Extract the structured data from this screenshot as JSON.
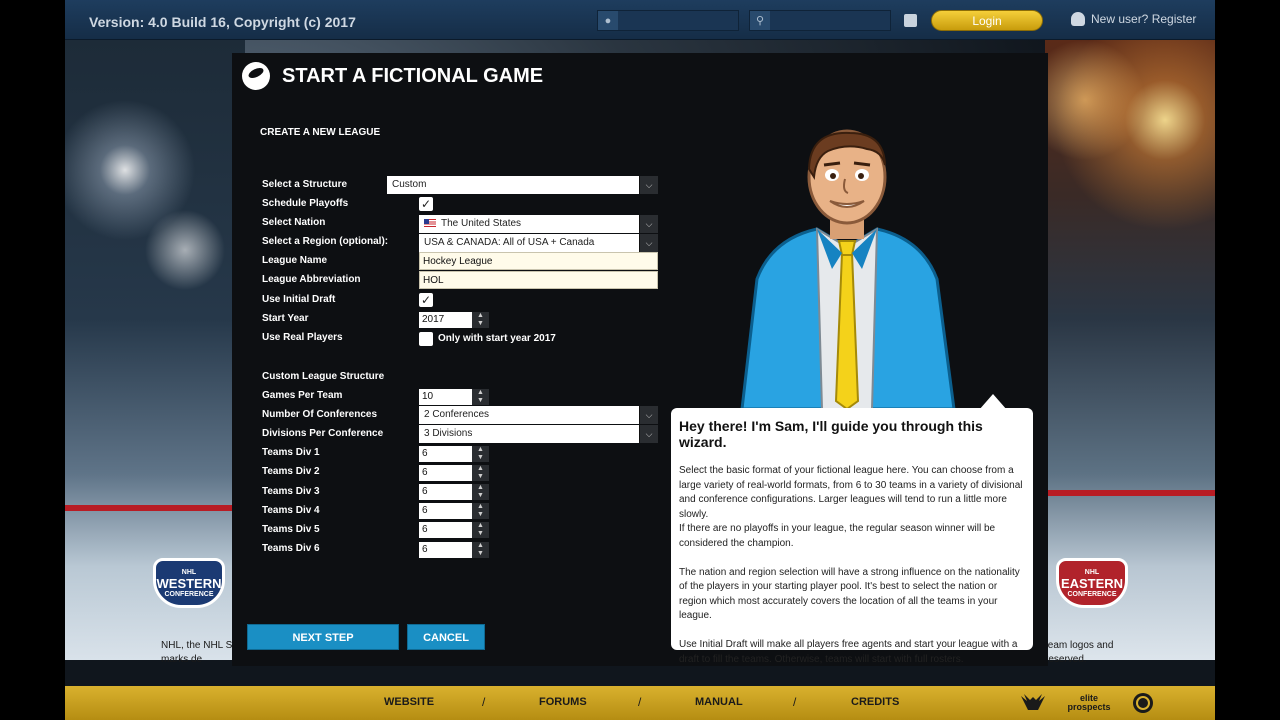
{
  "topbar": {
    "version": "Version: 4.0 Build 16, Copyright (c) 2017",
    "username_placeholder": "",
    "password_placeholder": "",
    "login_label": "Login",
    "register_label": "New user? Register"
  },
  "background": {
    "west_badge": {
      "top": "NHL",
      "main": "WESTERN",
      "sub": "CONFERENCE"
    },
    "east_badge": {
      "top": "NHL",
      "main": "EASTERN",
      "sub": "CONFERENCE"
    },
    "legal_left": "NHL, the NHL S marks de",
    "legal_right": "team logos and reserved."
  },
  "dialog": {
    "title": "START A FICTIONAL GAME",
    "section_title": "CREATE A NEW LEAGUE",
    "structure": {
      "label": "Select a Structure",
      "value": "Custom"
    },
    "playoffs": {
      "label": "Schedule Playoffs",
      "checked": true
    },
    "nation": {
      "label": "Select Nation",
      "value": "The United States"
    },
    "region": {
      "label": "Select a Region (optional):",
      "value": "USA & CANADA: All of USA + Canada"
    },
    "league_name": {
      "label": "League Name",
      "value": "Hockey League"
    },
    "league_abbr": {
      "label": "League Abbreviation",
      "value": "HOL"
    },
    "initial_draft": {
      "label": "Use Initial Draft",
      "checked": true
    },
    "start_year": {
      "label": "Start Year",
      "value": "2017"
    },
    "real_players": {
      "label": "Use Real Players",
      "checked": false,
      "option_label": "Only with start year 2017"
    },
    "custom_structure_title": "Custom League Structure",
    "games_per_team": {
      "label": "Games Per Team",
      "value": "10"
    },
    "conferences": {
      "label": "Number Of Conferences",
      "value": "2 Conferences"
    },
    "divisions": {
      "label": "Divisions Per Conference",
      "value": "3 Divisions"
    },
    "teams_div": [
      {
        "label": "Teams Div 1",
        "value": "6"
      },
      {
        "label": "Teams Div 2",
        "value": "6"
      },
      {
        "label": "Teams Div 3",
        "value": "6"
      },
      {
        "label": "Teams Div 4",
        "value": "6"
      },
      {
        "label": "Teams Div 5",
        "value": "6"
      },
      {
        "label": "Teams Div 6",
        "value": "6"
      }
    ],
    "next_label": "NEXT STEP",
    "cancel_label": "CANCEL"
  },
  "guide": {
    "heading": "Hey there! I'm Sam, I'll guide you through this wizard.",
    "para1": "Select the basic format of your fictional league here. You can choose from a large variety of real-world formats, from 6 to 30 teams in a variety of divisional and conference configurations. Larger leagues will tend to run a little more slowly.",
    "para1b": "If there are no playoffs in your league, the regular season winner will be considered the champion.",
    "para2": "The nation and region selection will have a strong influence on the nationality of the players in your starting player pool. It's best to select the nation or region which most accurately covers the location of all the teams in your league.",
    "para3": "Use Initial Draft will make all players free agents and start your league with a draft to fill the teams. Otherwise, teams will start with full rosters."
  },
  "footer": {
    "website": "WEBSITE",
    "forums": "FORUMS",
    "manual": "MANUAL",
    "credits": "CREDITS",
    "separator": "/",
    "brand2": "elite prospects"
  },
  "colors": {
    "accent_gold": "#d9b12e",
    "button_blue": "#1a8fc4",
    "topbar_navy": "#1e3d5e"
  }
}
